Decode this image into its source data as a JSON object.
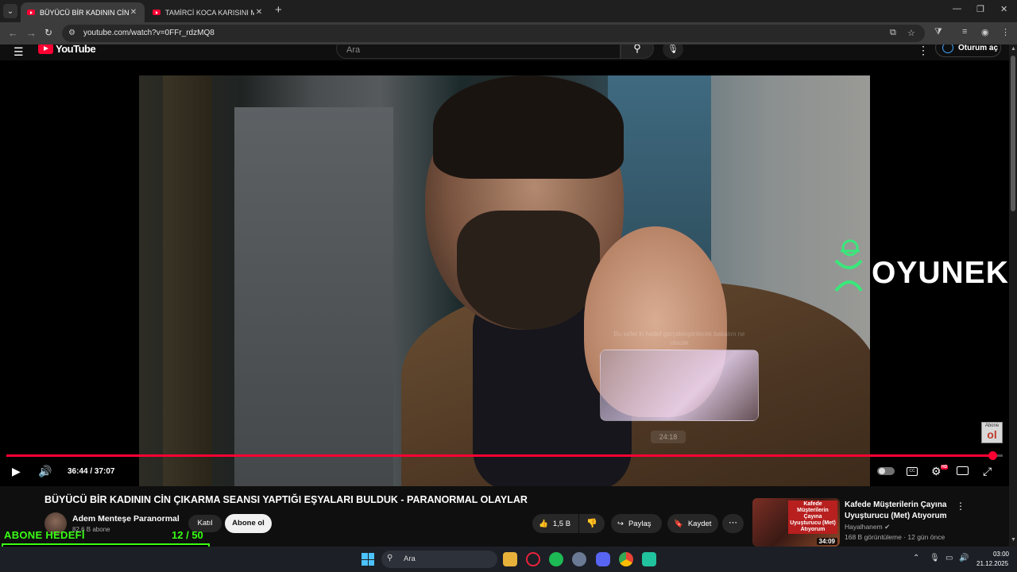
{
  "browser": {
    "tabs": [
      {
        "label": "BÜYÜCÜ BİR KADININ CİN ÇIKAR",
        "active": true
      },
      {
        "label": "TAMİRCİ KOCA KARISINI MÜŞT",
        "active": false
      }
    ],
    "url": "youtube.com/watch?v=0FFr_rdzMQ8"
  },
  "youtube": {
    "logo_text": "YouTube",
    "search_placeholder": "Ara",
    "sign_in_label": "Oturum aç"
  },
  "player": {
    "current_time": "36:44 / 37:07",
    "progress_fraction": 0.99,
    "hover_preview_time": "24:18",
    "hover_preview_label": "Bu sefer ki hedef gerçekleştirilecek bakalım ne olacak",
    "watermark_text": "OYUNEKS",
    "corner_badge_top": "Abone",
    "corner_badge_bottom": "ol"
  },
  "video": {
    "title": "BÜYÜCÜ BİR KADININ CİN ÇIKARMA SEANSI YAPTIĞI EŞYALARI BULDUK - PARANORMAL OLAYLAR",
    "channel_name": "Adem Menteşe Paranormal",
    "channel_subs": "82,6 B abone",
    "join_label": "Katıl",
    "subscribe_label": "Abone ol",
    "like_count": "1,5 B",
    "share_label": "Paylaş",
    "save_label": "Kaydet"
  },
  "recommendation": {
    "thumb_text": "Kafede Müşterilerin Çayına Uyuşturucu (Met) Atıyorum",
    "duration": "34:09",
    "title": "Kafede Müşterilerin Çayına Uyuşturucu (Met) Atıyorum",
    "channel": "Hayalhanem",
    "meta": "168 B görüntüleme · 12 gün önce"
  },
  "goal_overlay": {
    "label": "ABONE HEDEFİ",
    "current": "12",
    "target": "/ 50",
    "fraction": 0.24
  },
  "taskbar": {
    "search_placeholder": "Ara",
    "time": "03:00",
    "date": "21.12.2025"
  },
  "colors": {
    "youtube_red": "#ff0033",
    "goal_green": "#39ff14",
    "page_bg": "#0f0f0f"
  }
}
